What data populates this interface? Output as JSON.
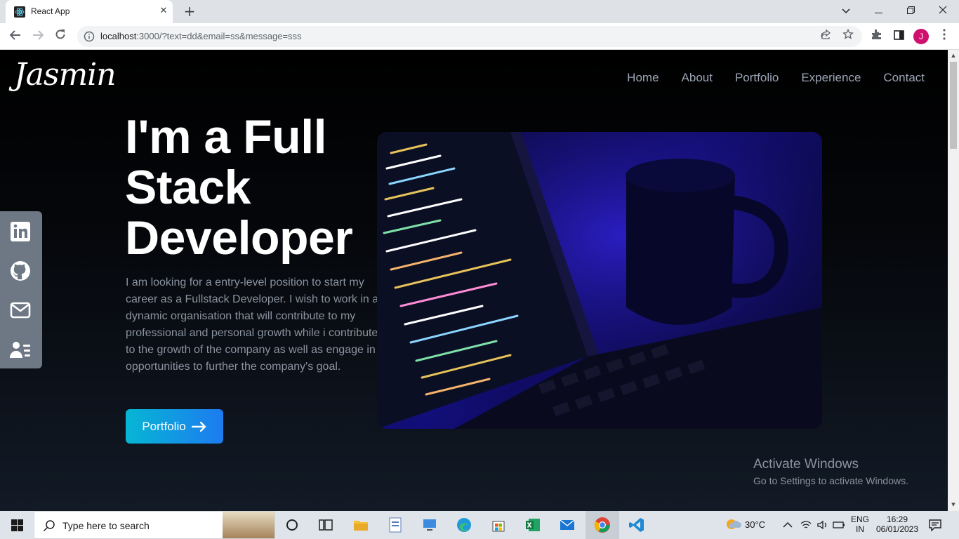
{
  "browser": {
    "tab_title": "React App",
    "url_host": "localhost",
    "url_rest": ":3000/?text=dd&email=ss&message=sss",
    "profile_initial": "J"
  },
  "site": {
    "logo": "Jasmin",
    "nav": [
      "Home",
      "About",
      "Portfolio",
      "Experience",
      "Contact"
    ],
    "hero_title_lines": [
      "I'm a Full",
      "Stack",
      "Developer"
    ],
    "hero_text": "I am looking for a entry-level position to start my career as a Fullstack Developer. I wish to work in a dynamic organisation that will contribute to my professional and personal growth while i contribute to the growth of the company as well as engage in opportunities to further the company's goal.",
    "cta_label": "Portfolio",
    "social": [
      "linkedin-icon",
      "github-icon",
      "mail-icon",
      "resume-icon"
    ]
  },
  "watermark": {
    "line1": "Activate Windows",
    "line2": "Go to Settings to activate Windows."
  },
  "taskbar": {
    "search_placeholder": "Type here to search",
    "temperature": "30°C",
    "lang1": "ENG",
    "lang2": "IN",
    "time": "16:29",
    "date": "06/01/2023"
  }
}
